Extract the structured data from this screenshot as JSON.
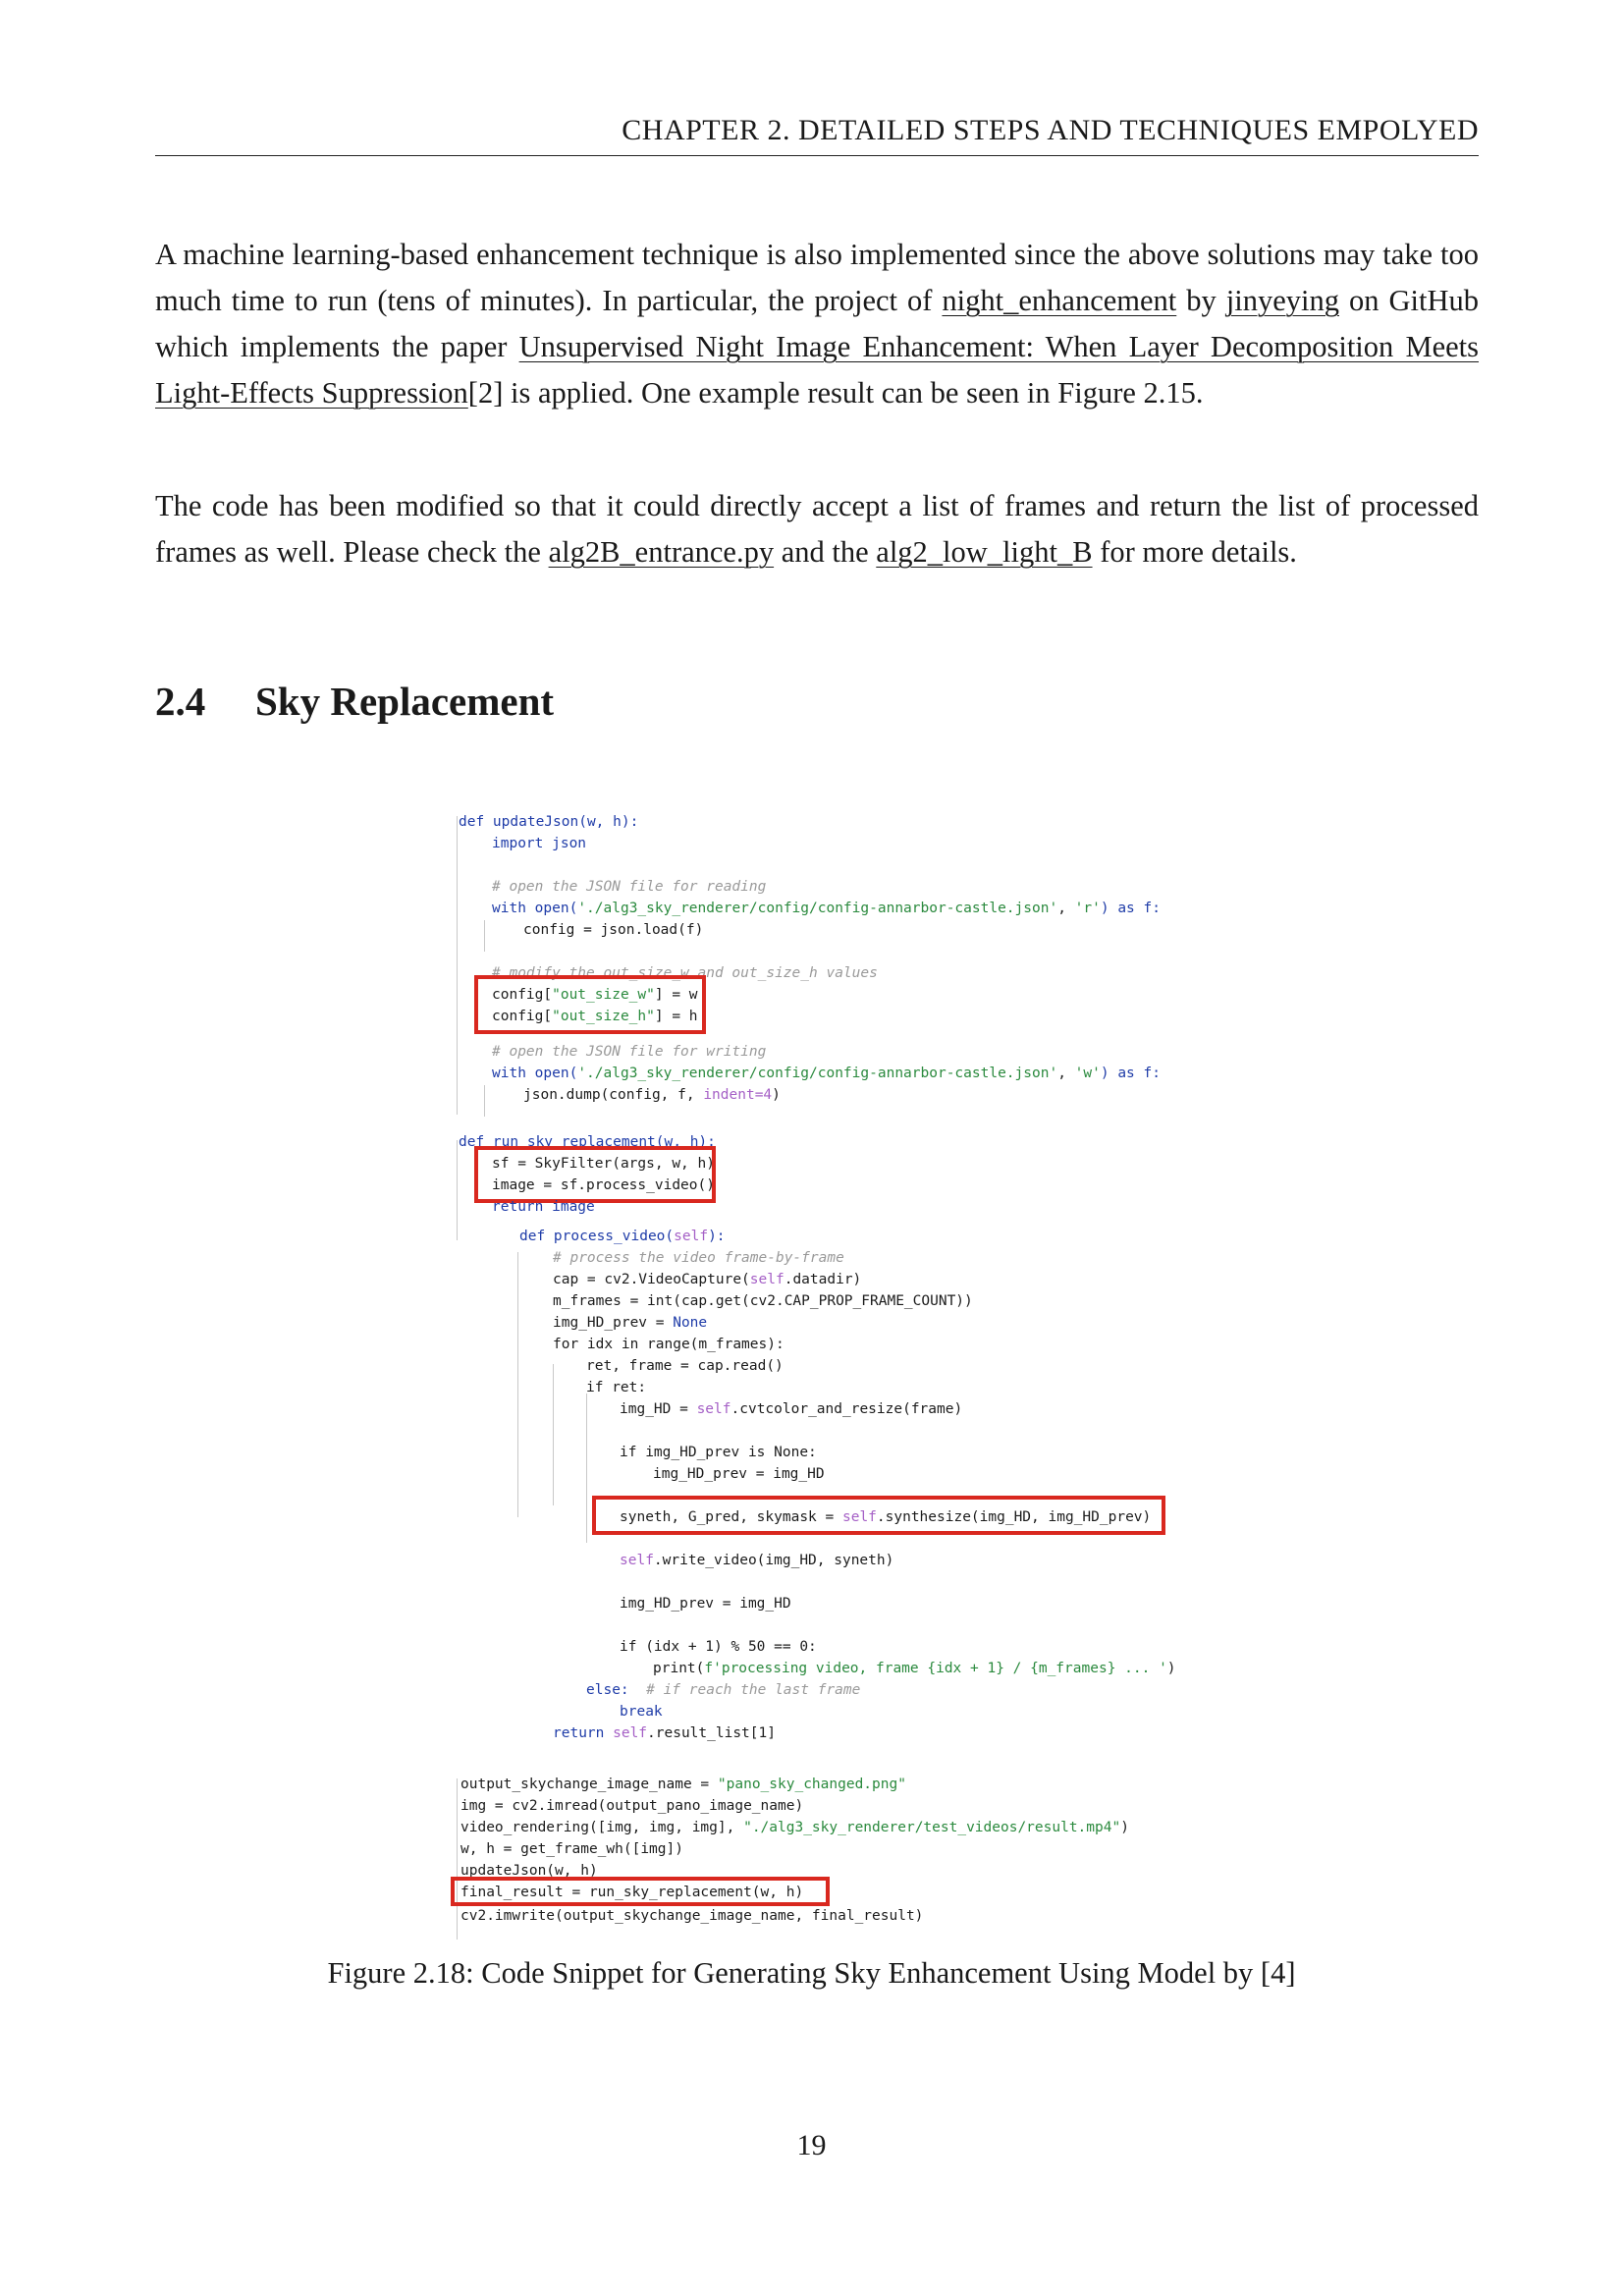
{
  "header": {
    "running_head": "CHAPTER 2.  DETAILED STEPS AND TECHNIQUES EMPOLYED"
  },
  "paragraph1": {
    "t1": "A machine learning-based enhancement technique is also implemented since the above solutions may take too much time to run (tens of minutes).  In particular, the project of ",
    "link_repo": "night_enhancement",
    "t2": " by ",
    "link_author": "jinyeying",
    "t3": " on GitHub which implements the paper ",
    "link_paper": "Unsupervised Night Image Enhancement: When Layer Decomposition Meets Light-Effects Suppression",
    "t4": "[2] is applied.  One example result can be seen in Figure 2.15."
  },
  "paragraph2": {
    "t1": "The code has been modified so that it could directly accept a list of frames and return the list of processed frames as well.  Please check the ",
    "link_file": "alg2B_entrance.py",
    "t2": " and the ",
    "link_dir": "alg2_low_light_B",
    "t3": " for more details."
  },
  "section": {
    "number": "2.4",
    "title": "Sky Replacement"
  },
  "code": {
    "l01": "def updateJson(w, h):",
    "l02": "import json",
    "l03": "# open the JSON file for reading",
    "l04a": "with open(",
    "l04b": "'./alg3_sky_renderer/config/config-annarbor-castle.json'",
    "l04c": ", ",
    "l04d": "'r'",
    "l04e": ") as f:",
    "l05": "config = json.load(f)",
    "l06": "# modify the out_size_w and out_size_h values",
    "l07a": "config[",
    "l07b": "\"out_size_w\"",
    "l07c": "] = w",
    "l08a": "config[",
    "l08b": "\"out_size_h\"",
    "l08c": "] = h",
    "l09": "# open the JSON file for writing",
    "l10a": "with open(",
    "l10b": "'./alg3_sky_renderer/config/config-annarbor-castle.json'",
    "l10c": ", ",
    "l10d": "'w'",
    "l10e": ") as f:",
    "l11a": "json.dump(config, f, ",
    "l11b": "indent=4",
    "l11c": ")",
    "l12": "def run_sky_replacement(w, h):",
    "l13": "sf = SkyFilter(args, w, h)",
    "l14": "image = sf.process_video()",
    "l15": "return image",
    "l16a": "def process_video(",
    "l16b": "self",
    "l16c": "):",
    "l17": "# process the video frame-by-frame",
    "l18a": "cap = cv2.VideoCapture(",
    "l18b": "self",
    "l18c": ".datadir)",
    "l19": "m_frames = int(cap.get(cv2.CAP_PROP_FRAME_COUNT))",
    "l20a": "img_HD_prev = ",
    "l20b": "None",
    "l21": "for idx in range(m_frames):",
    "l22": "ret, frame = cap.read()",
    "l23": "if ret:",
    "l24a": "img_HD = ",
    "l24b": "self",
    "l24c": ".cvtcolor_and_resize(frame)",
    "l25": "if img_HD_prev is None:",
    "l26": "img_HD_prev = img_HD",
    "l27a": "syneth, G_pred, skymask = ",
    "l27b": "self",
    "l27c": ".synthesize(img_HD, img_HD_prev)",
    "l28a": "self",
    "l28b": ".write_video(img_HD, syneth)",
    "l29": "img_HD_prev = img_HD",
    "l30": "if (idx + 1) % 50 == 0:",
    "l31a": "print(",
    "l31b": "f'processing video, frame {idx + 1} / {m_frames} ... '",
    "l31c": ")",
    "l32a": "else:",
    "l32b": "  # if reach the last frame",
    "l33": "break",
    "l34a": "return ",
    "l34b": "self",
    "l34c": ".result_list[1]",
    "l35a": "output_skychange_image_name = ",
    "l35b": "\"pano_sky_changed.png\"",
    "l36": "img = cv2.imread(output_pano_image_name)",
    "l37a": "video_rendering([img, img, img], ",
    "l37b": "\"./alg3_sky_renderer/test_videos/result.mp4\"",
    "l37c": ")",
    "l38": "w, h = get_frame_wh([img])",
    "l39": "updateJson(w, h)",
    "l40": "final_result = run_sky_replacement(w, h)",
    "l41": "cv2.imwrite(output_skychange_image_name, final_result)"
  },
  "caption": "Figure 2.18: Code Snippet for Generating Sky Enhancement Using Model by [4]",
  "page_number": "19",
  "colors": {
    "highlight_box": "#d9281f",
    "keyword": "#1f3ca8",
    "string": "#2b8a3e",
    "self": "#a560c6",
    "comment": "#9a9a9a"
  }
}
